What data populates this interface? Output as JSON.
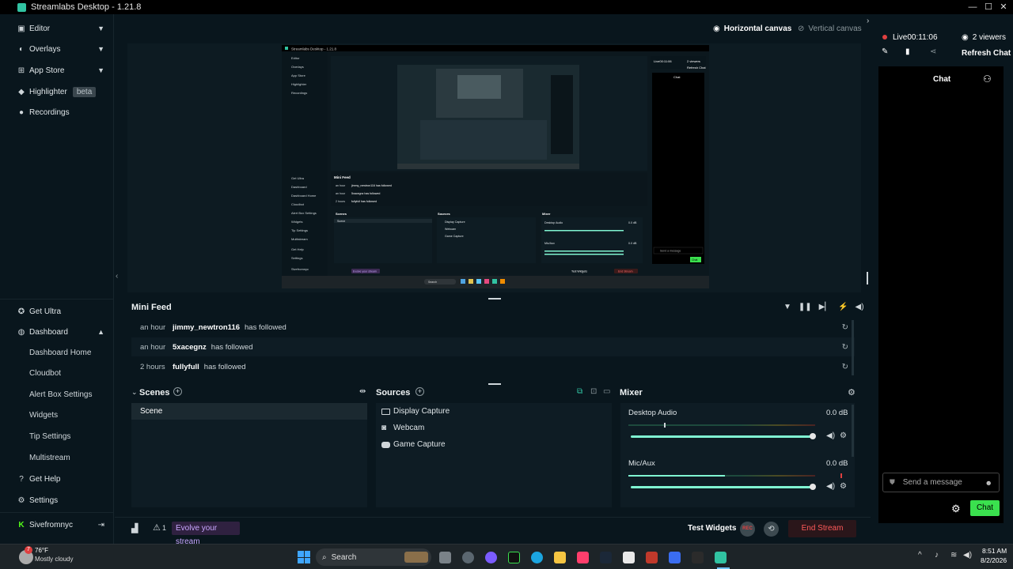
{
  "window": {
    "title": "Streamlabs Desktop - 1.21.8",
    "minimize": "—",
    "maximize": "☐",
    "close": "✕"
  },
  "sidebar": {
    "items": [
      {
        "label": "Editor",
        "icon": "editor-icon"
      },
      {
        "label": "Overlays",
        "icon": "overlays-icon"
      },
      {
        "label": "App Store",
        "icon": "app-store-icon"
      },
      {
        "label": "Highlighter",
        "badge": "beta",
        "icon": "highlighter-icon"
      },
      {
        "label": "Recordings",
        "icon": "recordings-icon"
      }
    ],
    "bottom": {
      "get_ultra": "Get Ultra",
      "dashboard": "Dashboard",
      "dashboard_sub": [
        "Dashboard Home",
        "Cloudbot",
        "Alert Box Settings",
        "Widgets",
        "Tip Settings",
        "Multistream"
      ],
      "get_help": "Get Help",
      "settings": "Settings",
      "account": "Sivefromnyc"
    }
  },
  "canvas": {
    "horizontal": "Horizontal canvas",
    "vertical": "Vertical canvas"
  },
  "mini_feed": {
    "title": "Mini Feed",
    "rows": [
      {
        "time": "an hour",
        "name": "jimmy_newtron116",
        "action": "has followed"
      },
      {
        "time": "an hour",
        "name": "5xacegnz",
        "action": "has followed"
      },
      {
        "time": "2 hours",
        "name": "fullyfull",
        "action": "has followed"
      }
    ]
  },
  "scenes": {
    "title": "Scenes",
    "items": [
      "Scene"
    ]
  },
  "sources": {
    "title": "Sources",
    "items": [
      "Display Capture",
      "Webcam",
      "Game Capture"
    ]
  },
  "mixer": {
    "title": "Mixer",
    "channels": [
      {
        "name": "Desktop Audio",
        "db": "0.0 dB"
      },
      {
        "name": "Mic/Aux",
        "db": "0.0 dB"
      }
    ]
  },
  "footer": {
    "alert_count": "1",
    "evolve": "Evolve your stream",
    "test_widgets": "Test Widgets",
    "rec": "REC",
    "end_stream": "End Stream"
  },
  "chat": {
    "live": "Live",
    "live_time": "00:11:06",
    "viewers": "2 viewers",
    "refresh": "Refresh Chat",
    "tab": "Chat",
    "placeholder": "Send a message",
    "send": "Chat"
  },
  "taskbar": {
    "temp": "76°F",
    "weather": "Mostly cloudy",
    "badge": "7",
    "search": "Search",
    "time": "8:51 AM",
    "date": "8/2/2026"
  },
  "colors": {
    "accent": "#31c3a2",
    "live_red": "#e04040",
    "end_stream": "#ff5a5a",
    "send": "#3ae04e"
  },
  "preview": {
    "title": "Streamlabs Desktop - 1.21.8",
    "live": "Live00:11:06",
    "viewers": "2 viewers",
    "refresh": "Refresh Chat",
    "chat": "Chat",
    "nav": [
      "Editor",
      "Overlays",
      "App Store",
      "Highlighter",
      "Recordings"
    ],
    "nav_bottom": [
      "Get Ultra",
      "Dashboard",
      "Dashboard Home",
      "Cloudbot",
      "Alert Box Settings",
      "Widgets",
      "Tip Settings",
      "Multistream",
      "Get Help",
      "Settings",
      "Sivefromnyc"
    ],
    "feed_title": "Mini Feed",
    "feed": [
      {
        "time": "an hour",
        "text": "jimmy_newtron116 has followed"
      },
      {
        "time": "an hour",
        "text": "5xacegnz has followed"
      },
      {
        "time": "2 hours",
        "text": "fullyfull has followed"
      }
    ],
    "scenes": "Scenes",
    "scene": "Scene",
    "sources": "Sources",
    "source_items": [
      "Display Capture",
      "Webcam",
      "Game Capture"
    ],
    "mixer": "Mixer",
    "desktop_audio": "Desktop Audio",
    "mic": "Mic/Aux",
    "db": "0.0 dB",
    "evolve": "Evolve your stream",
    "test_widgets": "Test Widgets",
    "end_stream": "End Stream",
    "send": "Send a message",
    "chat_btn": "Chat",
    "search": "Search"
  }
}
